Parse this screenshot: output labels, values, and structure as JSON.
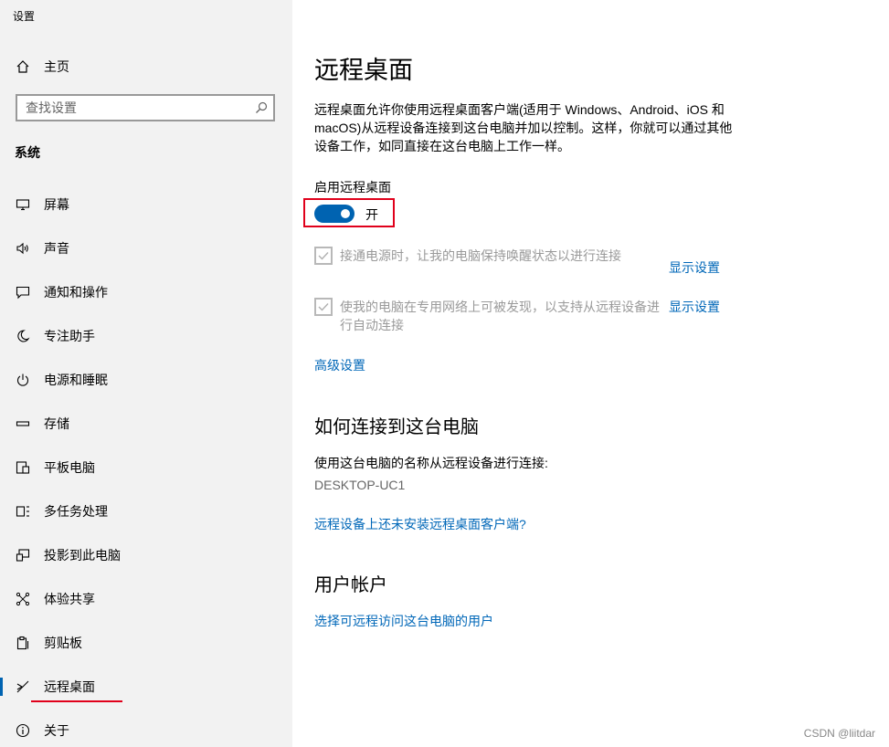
{
  "app": {
    "title": "设置"
  },
  "sidebar": {
    "home_label": "主页",
    "search_placeholder": "查找设置",
    "section_label": "系统",
    "items": [
      {
        "label": "屏幕",
        "icon": "monitor-icon"
      },
      {
        "label": "声音",
        "icon": "speaker-icon"
      },
      {
        "label": "通知和操作",
        "icon": "message-icon"
      },
      {
        "label": "专注助手",
        "icon": "moon-icon"
      },
      {
        "label": "电源和睡眠",
        "icon": "power-icon"
      },
      {
        "label": "存储",
        "icon": "drive-icon"
      },
      {
        "label": "平板电脑",
        "icon": "tablet-icon"
      },
      {
        "label": "多任务处理",
        "icon": "multitask-icon"
      },
      {
        "label": "投影到此电脑",
        "icon": "projection-icon"
      },
      {
        "label": "体验共享",
        "icon": "share-icon"
      },
      {
        "label": "剪贴板",
        "icon": "clipboard-icon"
      },
      {
        "label": "远程桌面",
        "icon": "remote-icon",
        "selected": true
      },
      {
        "label": "关于",
        "icon": "info-icon"
      }
    ]
  },
  "main": {
    "title": "远程桌面",
    "description": "远程桌面允许你使用远程桌面客户端(适用于 Windows、Android、iOS 和 macOS)从远程设备连接到这台电脑并加以控制。这样，你就可以通过其他设备工作，如同直接在这台电脑上工作一样。",
    "toggle_label": "启用远程桌面",
    "toggle_state": "开",
    "toggle_on": true,
    "option1": {
      "text": "接通电源时，让我的电脑保持唤醒状态以进行连接",
      "link": "显示设置",
      "checked": true,
      "disabled": true
    },
    "option2": {
      "text": "使我的电脑在专用网络上可被发现，以支持从远程设备进行自动连接",
      "link": "显示设置",
      "checked": true,
      "disabled": true
    },
    "advanced_link": "高级设置",
    "connect_heading": "如何连接到这台电脑",
    "connect_text": "使用这台电脑的名称从远程设备进行连接:",
    "pc_name": "DESKTOP-UC1",
    "client_link": "远程设备上还未安装远程桌面客户端?",
    "account_heading": "用户帐户",
    "account_link": "选择可远程访问这台电脑的用户"
  },
  "watermark": "CSDN @liitdar",
  "colors": {
    "accent": "#0063b1",
    "link": "#0067b8",
    "highlight": "#e0001b",
    "sidebar_bg": "#f2f2f2"
  }
}
